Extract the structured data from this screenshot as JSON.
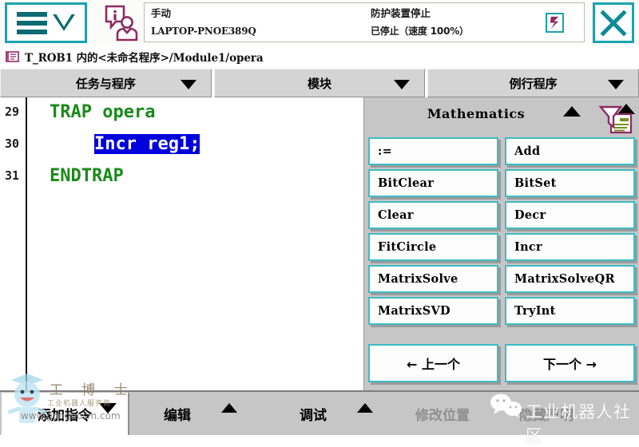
{
  "colors": {
    "accent_teal": "#1aa3b0",
    "button_border_teal": "#3dbcc4",
    "panel_gray": "#c6c6c6",
    "code_green": "#1a8a1a",
    "selection_blue": "#0000dd",
    "icon_purple": "#8e2a63"
  },
  "topbar": {
    "menu_icon": "hamburger-menu-icon",
    "menu_chevron": "chevron-down-icon",
    "info_icon": "info-operator-icon",
    "status": {
      "mode": "手动",
      "controller": "LAPTOP-PNOE389Q",
      "guard_state": "防护装置停止",
      "run_state": "已停止（速度 100%）"
    },
    "stop_icon": "emergency-stop-icon",
    "close_icon": "close-x-icon"
  },
  "breadcrumb": {
    "icon": "program-module-icon",
    "path": "T_ROB1 内的<未命名程序>/Module1/opera"
  },
  "tabs": [
    {
      "label": "任务与程序",
      "dropdown_icon": "chevron-down-icon"
    },
    {
      "label": "模块",
      "dropdown_icon": "chevron-down-icon"
    },
    {
      "label": "例行程序",
      "dropdown_icon": "chevron-down-icon"
    }
  ],
  "code": {
    "lines": [
      {
        "number": "29",
        "text": "TRAP opera",
        "indent": 18,
        "selected": false
      },
      {
        "number": "30",
        "text": "Incr reg1;",
        "indent": 82,
        "selected": true
      },
      {
        "number": "31",
        "text": "ENDTRAP",
        "indent": 18,
        "selected": false
      }
    ]
  },
  "panel": {
    "title": "Mathematics",
    "scroll_up_icon": "triangle-up-icon",
    "collapse_icon": "triangle-up-icon",
    "filter_icon": "filter-document-icon",
    "buttons": [
      [
        ":=",
        "Add"
      ],
      [
        "BitClear",
        "BitSet"
      ],
      [
        "Clear",
        "Decr"
      ],
      [
        "FitCircle",
        "Incr"
      ],
      [
        "MatrixSolve",
        "MatrixSolveQR"
      ],
      [
        "MatrixSVD",
        "TryInt"
      ]
    ],
    "nav": {
      "prev": "←  上一个",
      "next": "下一个  →"
    }
  },
  "bottombar": {
    "add_instruction": "添加指令",
    "add_instruction_icon": "triangle-down-icon",
    "items": [
      {
        "label": "编辑",
        "icon": "triangle-up-icon",
        "dim": false
      },
      {
        "label": "调试",
        "icon": "triangle-up-icon",
        "dim": false
      },
      {
        "label": "修改位置",
        "icon": "",
        "dim": true
      },
      {
        "label": "隐藏声明",
        "icon": "",
        "dim": true
      }
    ]
  },
  "watermarks": {
    "left_brand": "工 博 士",
    "left_sub": "工业机器人服务商",
    "left_url": "www.gongbosm.com",
    "right_text": "工业机器人社区",
    "right_icon": "wechat-icon"
  }
}
